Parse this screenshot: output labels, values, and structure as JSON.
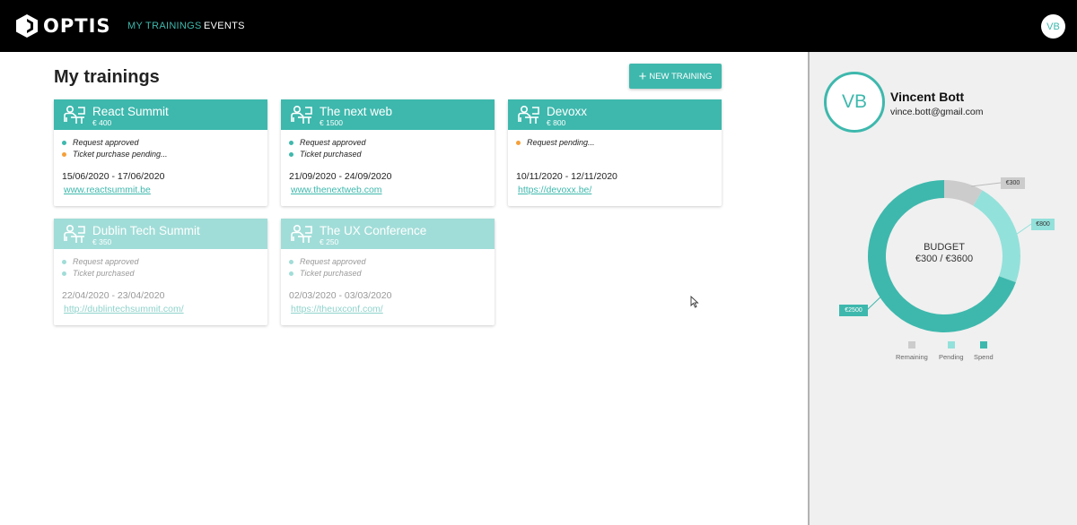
{
  "header": {
    "brand": "OPTIS",
    "nav": [
      {
        "label": "MY TRAININGS"
      },
      {
        "label": "EVENTS"
      }
    ],
    "avatar_initials": "VB"
  },
  "main": {
    "title": "My trainings",
    "new_button_label": "NEW TRAINING",
    "trainings": [
      {
        "name": "React Summit",
        "price": "€ 400",
        "statuses": [
          {
            "label": "Request approved",
            "color": "#3eb8ad"
          },
          {
            "label": "Ticket purchase pending...",
            "color": "#f5a03a"
          }
        ],
        "dates": "15/06/2020 - 17/06/2020",
        "link": "www.reactsummit.be",
        "faded": false
      },
      {
        "name": "The next web",
        "price": "€ 1500",
        "statuses": [
          {
            "label": "Request approved",
            "color": "#3eb8ad"
          },
          {
            "label": "Ticket purchased",
            "color": "#3eb8ad"
          }
        ],
        "dates": "21/09/2020 - 24/09/2020",
        "link": "www.thenextweb.com",
        "faded": false
      },
      {
        "name": "Devoxx",
        "price": "€ 800",
        "statuses": [
          {
            "label": "Request pending...",
            "color": "#f5a03a"
          }
        ],
        "dates": "10/11/2020 - 12/11/2020",
        "link": "https://devoxx.be/",
        "faded": false
      },
      {
        "name": "Dublin Tech Summit",
        "price": "€ 350",
        "statuses": [
          {
            "label": "Request approved",
            "color": "#a1ddd8"
          },
          {
            "label": "Ticket purchased",
            "color": "#a1ddd8"
          }
        ],
        "dates": "22/04/2020 - 23/04/2020",
        "link": "http://dublintechsummit.com/",
        "faded": true
      },
      {
        "name": "The UX Conference",
        "price": "€ 250",
        "statuses": [
          {
            "label": "Request approved",
            "color": "#a1ddd8"
          },
          {
            "label": "Ticket purchased",
            "color": "#a1ddd8"
          }
        ],
        "dates": "02/03/2020 - 03/03/2020",
        "link": "https://theuxconf.com/",
        "faded": true
      }
    ]
  },
  "profile": {
    "initials": "VB",
    "name": "Vincent Bott",
    "email": "vince.bott@gmail.com"
  },
  "budget": {
    "title": "BUDGET",
    "value": "€300 / €3600",
    "segments": [
      {
        "name": "Remaining",
        "amount": 300,
        "label": "€300",
        "color": "#cccccc"
      },
      {
        "name": "Pending",
        "amount": 800,
        "label": "€800",
        "color": "#93e1db"
      },
      {
        "name": "Spend",
        "amount": 2500,
        "label": "€2500",
        "color": "#3eb8ad"
      }
    ]
  },
  "colors": {
    "accent": "#3eb8ad",
    "accent_faded": "#a1ddd8",
    "pending": "#f5a03a"
  },
  "icons": {
    "card": "presenter-desk-icon",
    "new": "plus-icon",
    "brand": "optis-logo-icon"
  }
}
